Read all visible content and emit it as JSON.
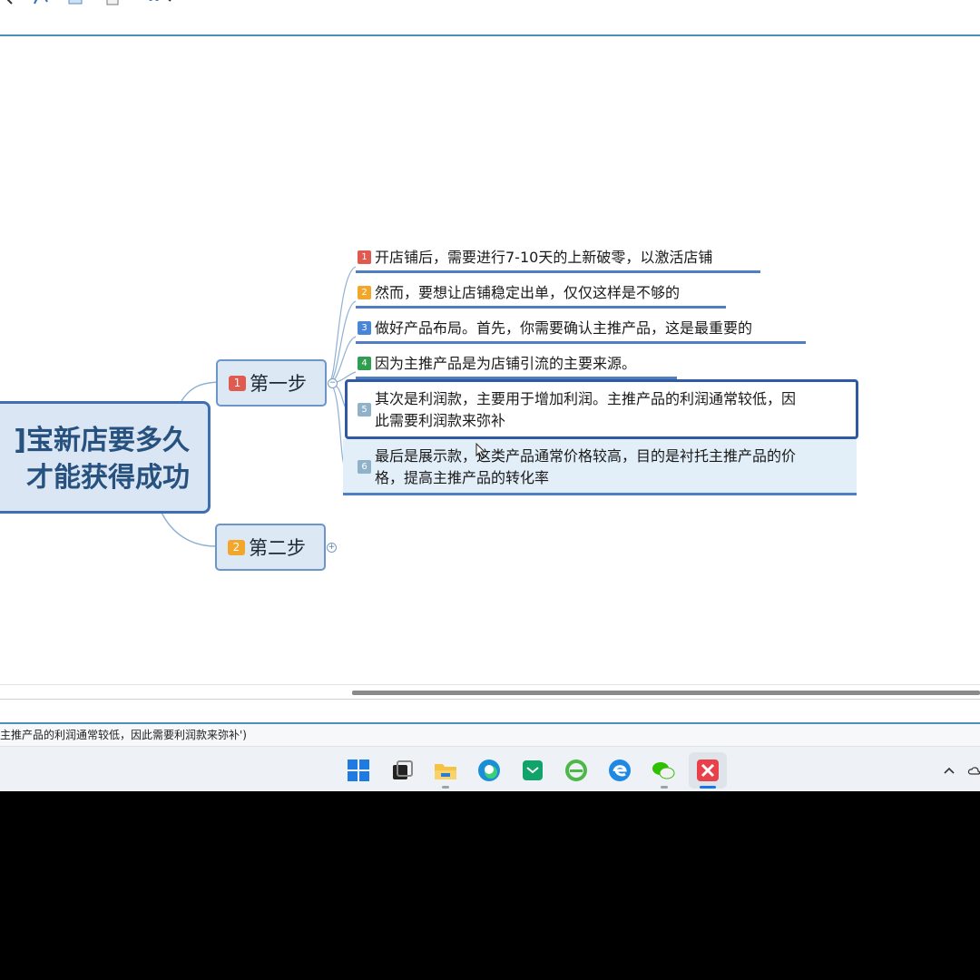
{
  "mindmap": {
    "central_topic": "淘宝新店要多久\n才能获得成功",
    "central_visible": "]宝新店要多久\n才能获得成功",
    "steps": [
      {
        "badge": "1",
        "label": "第一步",
        "badge_color": "#e05a4f",
        "collapse": "−"
      },
      {
        "badge": "2",
        "label": "第二步",
        "badge_color": "#f2a72a",
        "collapse": "+"
      }
    ],
    "items": [
      {
        "badge": "1",
        "badge_color": "#e05a4f",
        "text": "开店铺后，需要进行7-10天的上新破零，以激活店铺"
      },
      {
        "badge": "2",
        "badge_color": "#f2a72a",
        "text": "然而，要想让店铺稳定出单，仅仅这样是不够的"
      },
      {
        "badge": "3",
        "badge_color": "#4a86d8",
        "text": "做好产品布局。首先，你需要确认主推产品，这是最重要的"
      },
      {
        "badge": "4",
        "badge_color": "#2f9e4f",
        "text": "因为主推产品是为店铺引流的主要来源。"
      },
      {
        "badge": "5",
        "badge_color": "#8fb2c9",
        "text": "其次是利润款，主要用于增加利润。主推产品的利润通常较低，因\n此需要利润款来弥补"
      },
      {
        "badge": "6",
        "badge_color": "#8fb2c9",
        "text": "最后是展示款，这类产品通常价格较高，目的是衬托主推产品的价\n格，提高主推产品的转化率"
      }
    ]
  },
  "status": {
    "text": "主推产品的利润通常较低，因此需要利润款来弥补')"
  },
  "colors": {
    "accent": "#4a90b8",
    "node_border": "#6c96c8",
    "central_border": "#3f6fb0",
    "selected_border": "#2f5aa3"
  },
  "taskbar": {
    "icons": [
      "windows-start-icon",
      "task-view-icon",
      "file-explorer-icon",
      "edge-icon",
      "mail-icon",
      "ie-browser-icon",
      "edge-blue-icon",
      "wechat-icon",
      "xmind-icon"
    ],
    "tray": [
      "chevron-up-icon",
      "cloud-icon"
    ]
  }
}
